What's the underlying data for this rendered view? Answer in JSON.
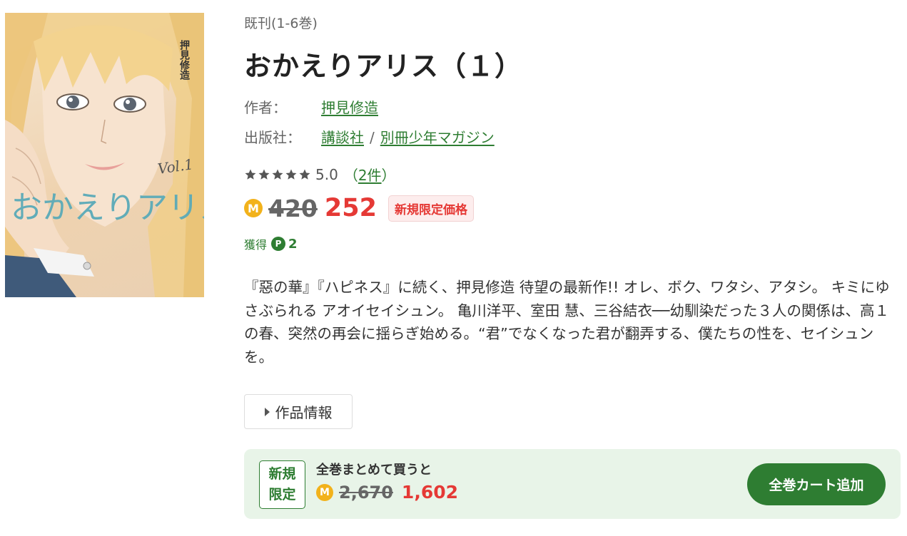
{
  "cover": {
    "title_art": "おかえりアリス",
    "volume_mark": "Vol.1",
    "author_vertical": "押見修造"
  },
  "product": {
    "series_note": "既刊(1-6巻)",
    "title": "おかえりアリス（１）",
    "author_label": "作者：",
    "author": "押見修造",
    "publisher_label": "出版社：",
    "publisher": "講談社",
    "publisher_separator": "/",
    "label": "別冊少年マガジン",
    "rating_value": "5.0",
    "rating_stars": 5,
    "review_open": "（",
    "review_count": "2件",
    "review_close": "）",
    "coin_symbol": "M",
    "price_original": "420",
    "price_sale": "252",
    "limited_badge": "新規限定価格",
    "points_label": "獲得",
    "points_icon": "P",
    "points_value": "2",
    "description": "『惡の華』『ハピネス』に続く、押見修造 待望の最新作!! オレ、ボク、ワタシ、アタシ。 キミにゆさぶられる アオイセイシュン。 亀川洋平、室田 慧、三谷結衣──幼馴染だった３人の関係は、高１の春、突然の再会に揺らぎ始める。“君”でなくなった君が翻弄する、僕たちの性を、セイシュンを。",
    "info_toggle_label": "作品情報"
  },
  "bundle": {
    "badge_line1": "新規",
    "badge_line2": "限定",
    "label": "全巻まとめて買うと",
    "price_original": "2,670",
    "price_sale": "1,602",
    "button_label": "全巻カート追加"
  },
  "colors": {
    "accent_green": "#2e7d32",
    "sale_red": "#e53935",
    "coin_gold": "#f2b21b",
    "bundle_bg": "#e8f4e8"
  }
}
